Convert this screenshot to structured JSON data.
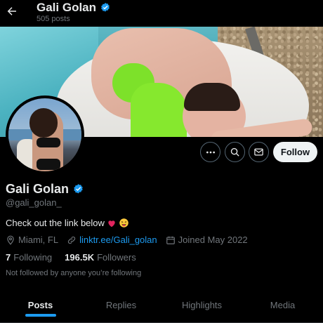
{
  "header": {
    "name": "Gali Golan",
    "post_count": "505 posts"
  },
  "profile": {
    "name": "Gali Golan",
    "handle": "@gali_golan_",
    "bio": "Check out the link below",
    "location": "Miami, FL",
    "link": "linktr.ee/Gali_golan",
    "joined": "Joined May 2022",
    "following_count": "7",
    "following_label": "Following",
    "followers_count": "196.5K",
    "followers_label": "Followers",
    "not_followed_text": "Not followed by anyone you’re following"
  },
  "actions": {
    "follow_label": "Follow"
  },
  "tabs": [
    {
      "label": "Posts",
      "active": true
    },
    {
      "label": "Replies",
      "active": false
    },
    {
      "label": "Highlights",
      "active": false
    },
    {
      "label": "Media",
      "active": false
    }
  ],
  "colors": {
    "background": "#000000",
    "accent": "#1d9bf0",
    "secondary_text": "#71767b",
    "verified_badge": "#1d9bf0",
    "follow_button": "#eff3f4"
  },
  "icons": {
    "back": "arrow-left-icon",
    "verified": "verified-badge-icon",
    "more": "more-horizontal-icon",
    "search": "search-icon",
    "message": "mail-icon",
    "location": "location-pin-icon",
    "link": "link-icon",
    "calendar": "calendar-icon",
    "bio_emoji_1": "red-heart-emoji",
    "bio_emoji_2": "squinting-tongue-emoji"
  }
}
